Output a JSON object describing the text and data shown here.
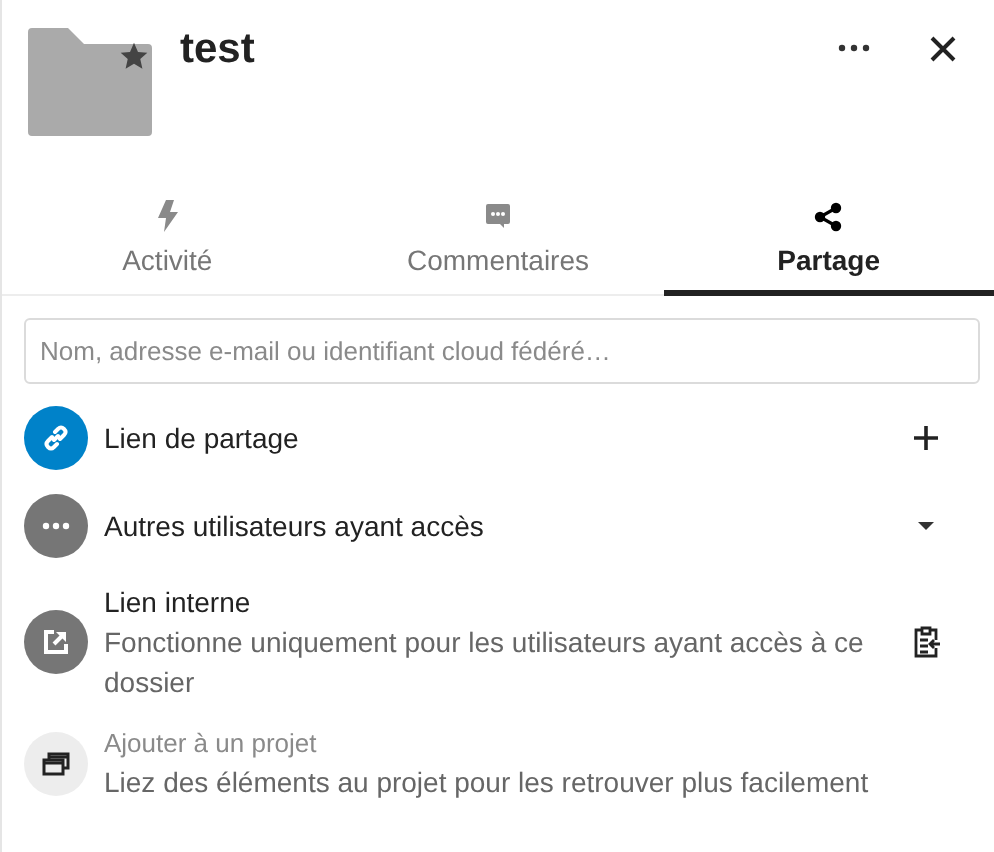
{
  "header": {
    "title": "test",
    "starred": true
  },
  "tabs": [
    {
      "label": "Activité",
      "kind": "activity",
      "selected": false
    },
    {
      "label": "Commentaires",
      "kind": "comments",
      "selected": false
    },
    {
      "label": "Partage",
      "kind": "sharing",
      "selected": true
    }
  ],
  "search": {
    "placeholder": "Nom, adresse e-mail ou identifiant cloud fédéré…"
  },
  "entries": [
    {
      "kind": "share-link",
      "title": "Lien de partage"
    },
    {
      "kind": "others",
      "title": "Autres utilisateurs ayant accès"
    },
    {
      "kind": "internal",
      "title": "Lien interne",
      "subtitle": "Fonctionne uniquement pour les utilisateurs ayant accès à ce dossier"
    },
    {
      "kind": "project",
      "title": "Ajouter à un projet",
      "subtitle": "Liez des éléments au projet pour les retrouver plus facilement"
    }
  ]
}
